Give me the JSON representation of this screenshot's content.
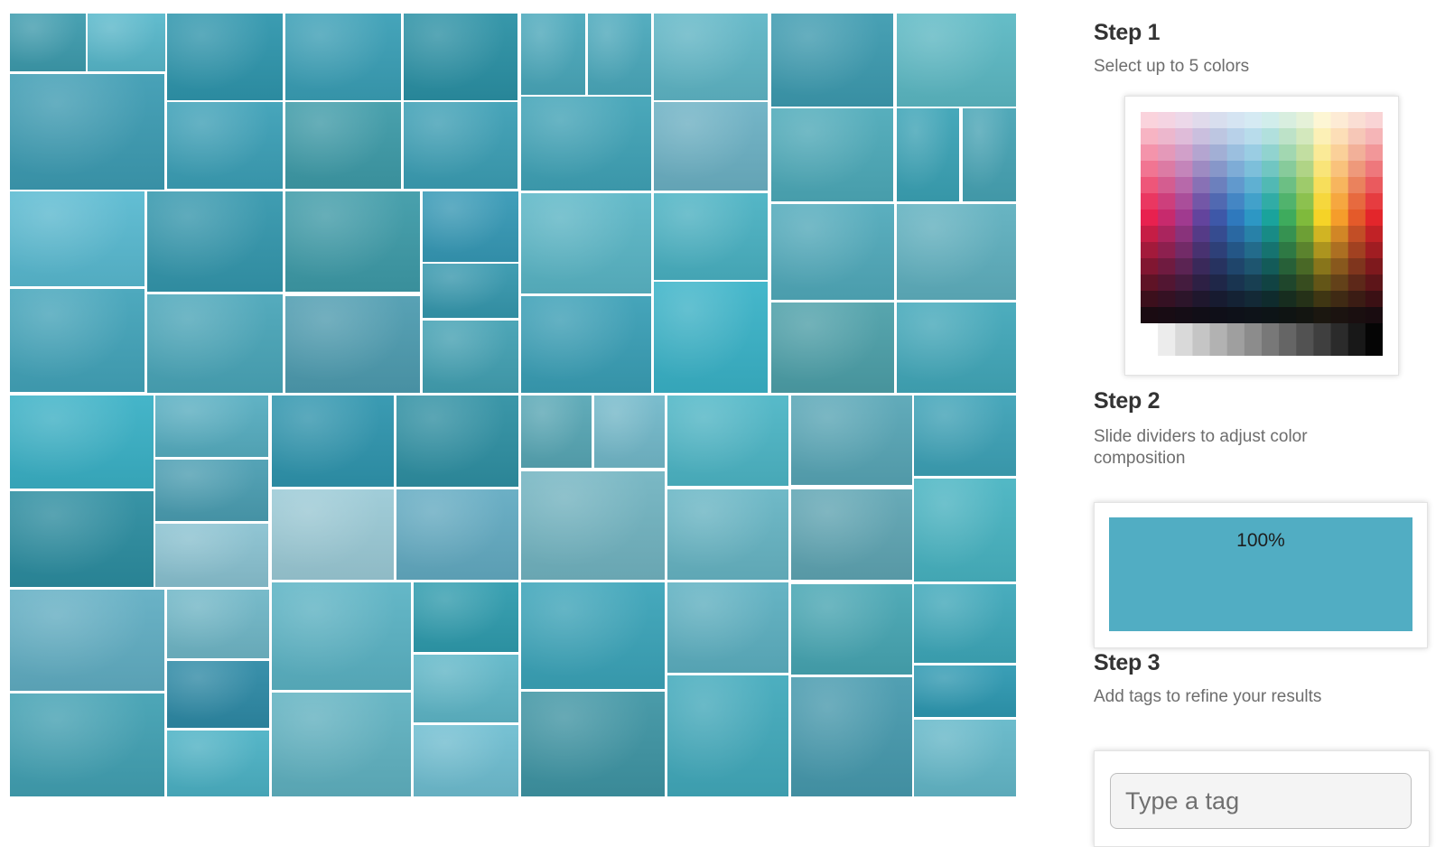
{
  "mosaic": {
    "photos": [
      "#3e9cae",
      "#58b8cb",
      "#2f96ad",
      "#3a9fb6",
      "#2b91a5",
      "#4aa8bb",
      "#4ba9bc",
      "#5fb6c6",
      "#3d9bb0",
      "#5cb9c4",
      "#3d9cb3",
      "#3ca0b7",
      "#3e9ba8",
      "#3c9fb5",
      "#40a3b7",
      "#6cb1c4",
      "#4daab9",
      "#3ba3b6",
      "#47a4b5",
      "#59bad1",
      "#3497ad",
      "#3e9ba8",
      "#3699b6",
      "#5ab6c6",
      "#4ab2c3",
      "#51aabb",
      "#5fb0bf",
      "#43a4ba",
      "#4aa6b9",
      "#4e9cb0",
      "#3698ae",
      "#43a1b3",
      "#3a9fb6",
      "#3ab3c8",
      "#4da0a9",
      "#42a8ba",
      "#3ab1c6",
      "#57aec1",
      "#2f95ae",
      "#2f90a3",
      "#58a7b5",
      "#73b9ca",
      "#4db6c6",
      "#58a6b6",
      "#3da2b7",
      "#2c8da0",
      "#4b9eb2",
      "#8ac2d1",
      "#9bcad6",
      "#63abc2",
      "#72b4c1",
      "#67b5c4",
      "#5fa5b3",
      "#48b4c2",
      "#61aec3",
      "#70b7c7",
      "#5bb3c4",
      "#2f9cae",
      "#3ba4b9",
      "#5db0c1",
      "#47a6b3",
      "#3ea8ba",
      "#42a1b3",
      "#2e8aa6",
      "#4cb2c5",
      "#60b2c1",
      "#5fb7c8",
      "#6fbed1",
      "#3f95a4",
      "#42aabc",
      "#479aae",
      "#2e99b2",
      "#64b8c9",
      "#4a9fb1",
      "#41acbd",
      "#70b6c4",
      "#94c8d5",
      "#4fa9b8",
      "#5cacbc"
    ]
  },
  "steps": [
    {
      "title": "Step 1",
      "description": "Select up to 5 colors"
    },
    {
      "title": "Step 2",
      "description": "Slide dividers to adjust color composition"
    },
    {
      "title": "Step 3",
      "description": "Add tags to refine your results"
    }
  ],
  "color_picker": {
    "hues": [
      "#e8214f",
      "#c72a6d",
      "#a03a8f",
      "#63449d",
      "#3e58a8",
      "#2f79bd",
      "#2d97c4",
      "#1aa39c",
      "#3eab5d",
      "#7fba3c",
      "#f5d327",
      "#f59d2b",
      "#e45a2a",
      "#e3262b"
    ],
    "grayscale_steps": 14
  },
  "composition": {
    "selected_colors": [
      "#51adc3"
    ],
    "shares": [
      100
    ],
    "percent_label": "100%"
  },
  "tags": {
    "input_placeholder": "Type a tag",
    "input_value": ""
  }
}
